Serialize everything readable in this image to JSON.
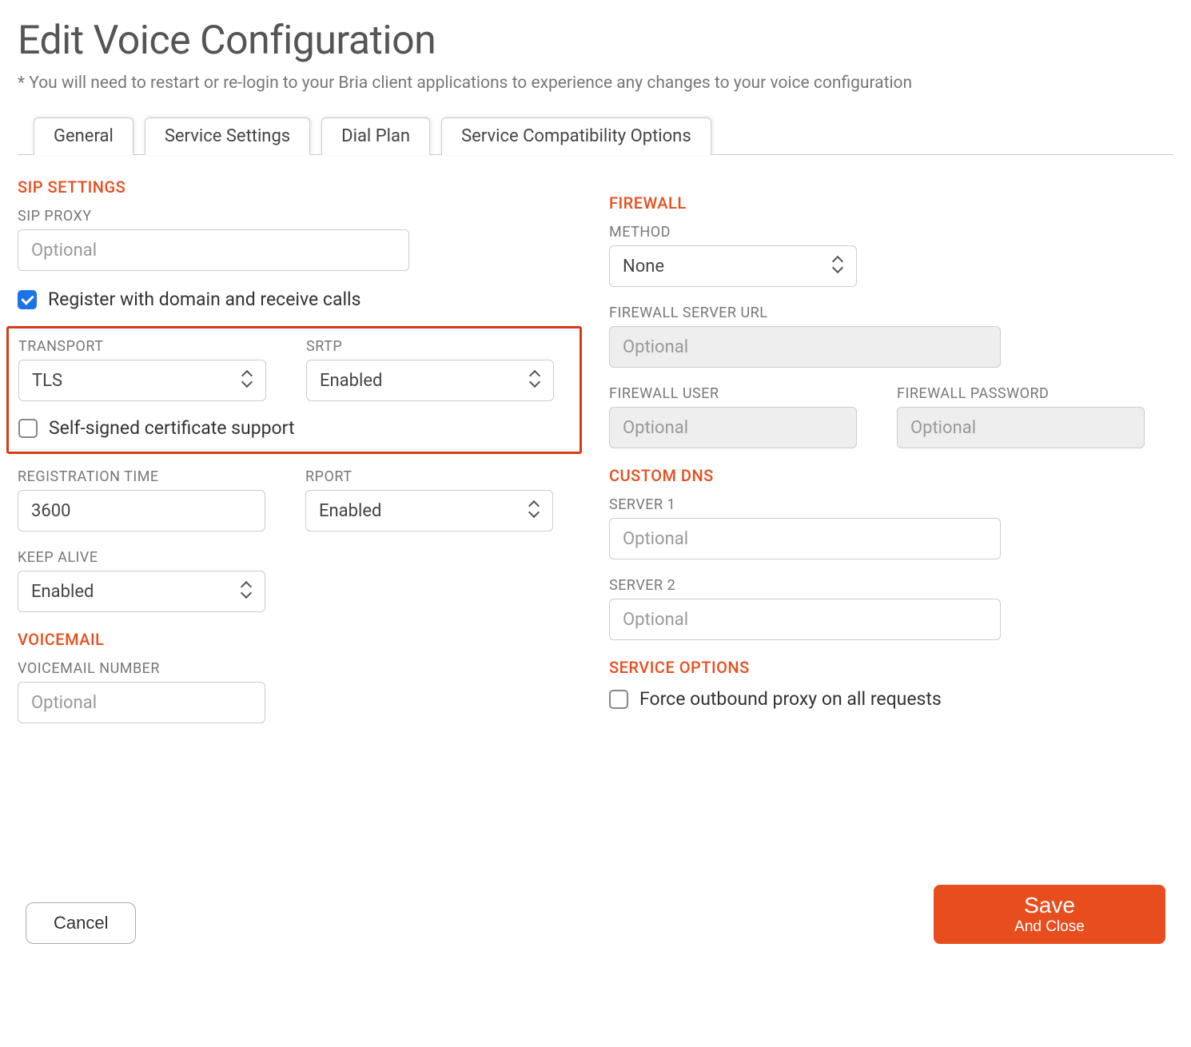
{
  "page": {
    "title": "Edit Voice Configuration",
    "note": "* You will need to restart or re-login to your Bria client applications to experience any changes to your voice configuration"
  },
  "tabs": {
    "general": "General",
    "service_settings": "Service Settings",
    "dial_plan": "Dial Plan",
    "compat": "Service Compatibility Options",
    "active": "service_settings"
  },
  "sip": {
    "section": "SIP SETTINGS",
    "proxy_label": "SIP PROXY",
    "proxy_placeholder": "Optional",
    "register_label": "Register with domain and receive calls",
    "register_checked": true,
    "transport_label": "TRANSPORT",
    "transport_value": "TLS",
    "srtp_label": "SRTP",
    "srtp_value": "Enabled",
    "selfsigned_label": "Self-signed certificate support",
    "selfsigned_checked": false,
    "regtime_label": "REGISTRATION TIME",
    "regtime_value": "3600",
    "rport_label": "RPORT",
    "rport_value": "Enabled",
    "keepalive_label": "KEEP ALIVE",
    "keepalive_value": "Enabled"
  },
  "voicemail": {
    "section": "VOICEMAIL",
    "number_label": "VOICEMAIL NUMBER",
    "number_placeholder": "Optional"
  },
  "firewall": {
    "section": "FIREWALL",
    "method_label": "METHOD",
    "method_value": "None",
    "server_url_label": "FIREWALL SERVER URL",
    "server_url_placeholder": "Optional",
    "user_label": "FIREWALL USER",
    "user_placeholder": "Optional",
    "password_label": "FIREWALL PASSWORD",
    "password_placeholder": "Optional"
  },
  "dns": {
    "section": "CUSTOM DNS",
    "server1_label": "SERVER 1",
    "server1_placeholder": "Optional",
    "server2_label": "SERVER 2",
    "server2_placeholder": "Optional"
  },
  "service_options": {
    "section": "SERVICE OPTIONS",
    "force_proxy_label": "Force outbound proxy on all requests",
    "force_proxy_checked": false
  },
  "footer": {
    "cancel": "Cancel",
    "save_main": "Save",
    "save_sub": "And Close"
  }
}
